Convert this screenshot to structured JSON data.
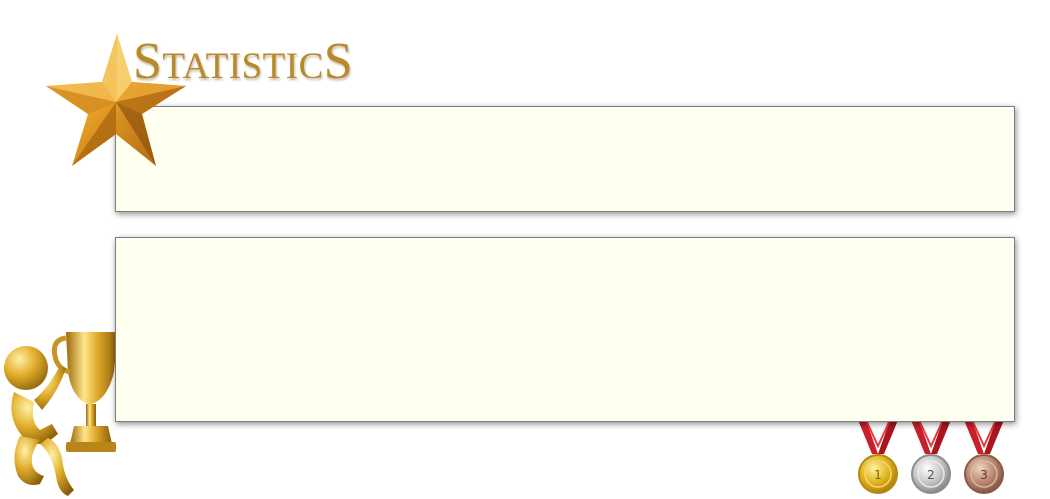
{
  "header": {
    "title_first": "S",
    "title_middle": "tatistic",
    "title_last": "S"
  },
  "decor": {
    "star_icon": "star-icon",
    "trophy_icon": "golden-figure-trophy-icon",
    "medals": [
      {
        "icon": "gold-medal-icon",
        "number": "1",
        "color": "#e0b21d"
      },
      {
        "icon": "silver-medal-icon",
        "number": "2",
        "color": "#c4c4c6"
      },
      {
        "icon": "bronze-medal-icon",
        "number": "3",
        "color": "#b88670"
      }
    ]
  },
  "colors": {
    "title": "#b98a2a",
    "panel_background": "#fffff0",
    "panel_border": "#7d7d7d",
    "ribbon": "#c8202b"
  },
  "panels": {
    "top": {
      "content": ""
    },
    "bottom": {
      "content": ""
    }
  }
}
